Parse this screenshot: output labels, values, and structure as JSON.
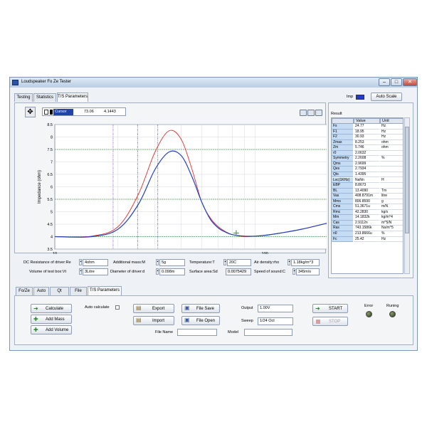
{
  "window": {
    "title": "Loudspeaker Fo Ze Tester"
  },
  "top_tabs": [
    "Testing",
    "Statistics",
    "T/S Parameters"
  ],
  "imp_label": "Imp",
  "auto_scale": "Auto Scale",
  "cursor": {
    "name": "Cursor",
    "x": "73.06",
    "y": "4.1443"
  },
  "chart_data": {
    "type": "line",
    "x_scale": "log",
    "xlim": [
      10,
      200
    ],
    "ylim": [
      3.5,
      8.5
    ],
    "ylabel": "Impedance (ohm)",
    "x_ticks": [
      "10",
      "100"
    ],
    "y_ticks": [
      "3.5",
      "4",
      "4.5",
      "5",
      "5.5",
      "6",
      "6.5",
      "7",
      "7.5",
      "8",
      "8.5"
    ],
    "series": [
      {
        "color": "#e03030",
        "x": [
          10,
          15,
          20,
          25,
          30,
          35,
          40,
          45,
          50,
          55,
          60,
          65,
          70,
          80,
          90,
          100,
          120,
          150,
          200
        ],
        "y": [
          4.0,
          4.02,
          4.4,
          5.7,
          7.4,
          8.25,
          7.9,
          6.7,
          5.4,
          4.75,
          4.4,
          4.2,
          4.08,
          4.0,
          4.02,
          4.06,
          4.15,
          4.3,
          4.55
        ]
      },
      {
        "color": "#2040c8",
        "x": [
          10,
          15,
          20,
          25,
          30,
          35,
          40,
          45,
          50,
          55,
          60,
          65,
          70,
          80,
          90,
          100,
          120,
          150,
          200
        ],
        "y": [
          4.0,
          4.0,
          4.3,
          5.3,
          6.7,
          7.4,
          7.25,
          6.4,
          5.4,
          4.7,
          4.35,
          4.18,
          4.08,
          4.02,
          4.02,
          4.05,
          4.15,
          4.3,
          4.55
        ]
      }
    ],
    "vlines": {
      "blue": [
        24.77,
        30.93
      ],
      "purple": [
        18.95
      ],
      "red": [
        24.77
      ]
    },
    "hlines": [
      7.5,
      5.5,
      4.0
    ]
  },
  "result": {
    "title": "Result",
    "headers": [
      "",
      "Value",
      "Unit"
    ],
    "rows": [
      [
        "Fs",
        "24.77",
        "Hz"
      ],
      [
        "F1",
        "18.95",
        "Hz"
      ],
      [
        "F2",
        "30.93",
        "Hz"
      ],
      [
        "Zmax",
        "8.253",
        "ohm"
      ],
      [
        "Zm",
        "5.746",
        "ohm"
      ],
      [
        "r0",
        "2.0632",
        ""
      ],
      [
        "Symmetry",
        "2.2608",
        "%"
      ],
      [
        "Qms",
        "2.9699",
        ""
      ],
      [
        "Qes",
        "2.7934",
        ""
      ],
      [
        "Qts",
        "1.4395",
        ""
      ],
      [
        "Lvc(1KHz)",
        "NaNn",
        "H"
      ],
      [
        "EBP",
        "8.8673",
        ""
      ],
      [
        "BL",
        "13.4090",
        "Tm"
      ],
      [
        "Vas",
        "408.8791m",
        "litre"
      ],
      [
        "Mms",
        "806.8590",
        "g"
      ],
      [
        "Cms",
        "51.3671u",
        "m/N"
      ],
      [
        "Rmc",
        "42.2830",
        "kg/s"
      ],
      [
        "Mm",
        "14.1832k",
        "kg/m^4"
      ],
      [
        "Cas",
        "2.9112n",
        "m^5/N"
      ],
      [
        "Ras",
        "743.1586k",
        "Ns/m^5"
      ],
      [
        "n0",
        "213.8666u",
        "%"
      ],
      [
        "Fc",
        "25.42",
        "Hz"
      ]
    ]
  },
  "params": {
    "dc_label": "DC Resistance of driver:Re",
    "dc_value": "4ohm",
    "mass_label": "Additional mass:M",
    "mass_value": "5g",
    "temp_label": "Temperature:T",
    "temp_value": "20C",
    "air_label": "Air density:rho",
    "air_value": "1.18kg/m^3",
    "vol_label": "Volume of test box:Vt",
    "vol_value": "3Litre",
    "diam_label": "Diameter of driver:d",
    "diam_value": "0.098m",
    "surf_label": "Surface area:Sd",
    "surf_value": "0.0075429",
    "speed_label": "Speed of sound:C",
    "speed_value": "345m/s"
  },
  "bottom_tabs": [
    "Fo/Ze",
    "Auto",
    "Qt",
    "File",
    "T/S Parameters"
  ],
  "controls": {
    "calculate": "Calculate",
    "add_mass": "Add Mass",
    "add_volume": "Add Volume",
    "auto_calc": "Auto calculate",
    "export": "Export",
    "import": "Import",
    "file_save": "File Save",
    "file_open": "File Open",
    "file_name": "File Name",
    "model": "Model",
    "output_label": "Output",
    "output_value": "1.00V",
    "sweep_label": "Sweep",
    "sweep_value": "1/24 Oct",
    "start": "START",
    "stop": "STOP",
    "error": "Error",
    "running": "Runing"
  }
}
